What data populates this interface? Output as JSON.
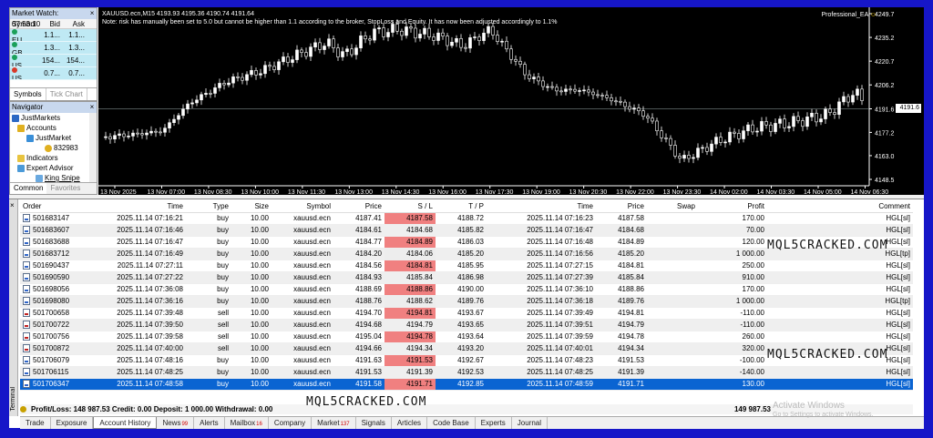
{
  "market_watch": {
    "title": "Market Watch: 07:53:10",
    "headers": [
      "Symbol",
      "Bid",
      "Ask"
    ],
    "rows": [
      {
        "symbol": "EU...",
        "bid": "1.1...",
        "ask": "1.1...",
        "color": "#1aa05a"
      },
      {
        "symbol": "GB...",
        "bid": "1.3...",
        "ask": "1.3...",
        "color": "#1aa05a"
      },
      {
        "symbol": "US...",
        "bid": "154...",
        "ask": "154...",
        "color": "#1aa05a"
      },
      {
        "symbol": "US...",
        "bid": "0.7...",
        "ask": "0.7...",
        "color": "#d83a2a"
      }
    ],
    "tabs": [
      "Symbols",
      "Tick Chart"
    ]
  },
  "navigator": {
    "title": "Navigator",
    "items": [
      "JustMarkets",
      "Accounts",
      "JustMarket",
      "832983",
      "Indicators",
      "Expert Advisor",
      "King Snipe"
    ],
    "tabs": [
      "Common",
      "Favorites"
    ]
  },
  "chart": {
    "symbol_line": "XAUUSD.ecn,M15  4193.93 4195.36 4190.74 4191.64",
    "note": "Note: risk has manually been set to 5.0 but cannot be higher than 1.1 according to the broker, StopLoss and Equity. It has now been adjusted accordingly to 1.1%",
    "ea_name": "Professional_EA",
    "price_labels": [
      "4249.7",
      "4235.2",
      "4220.7",
      "4206.2",
      "4191.6",
      "4177.2",
      "4163.0",
      "4148.5"
    ],
    "current_price": "4191.6",
    "time_labels": [
      "13 Nov 2025",
      "13 Nov 07:00",
      "13 Nov 08:30",
      "13 Nov 10:00",
      "13 Nov 11:30",
      "13 Nov 13:00",
      "13 Nov 14:30",
      "13 Nov 16:00",
      "13 Nov 17:30",
      "13 Nov 19:00",
      "13 Nov 20:30",
      "13 Nov 22:00",
      "13 Nov 23:30",
      "14 Nov 02:00",
      "14 Nov 03:30",
      "14 Nov 05:00",
      "14 Nov 06:30"
    ],
    "colors": {
      "bull": "#ffffff",
      "bear": "#000000",
      "grid": "#ffffff"
    }
  },
  "terminal": {
    "side_label": "Terminal",
    "headers": [
      "Order",
      "Time",
      "Type",
      "Size",
      "Symbol",
      "Price",
      "S / L",
      "T / P",
      "Time",
      "Price",
      "Swap",
      "Profit",
      "Comment"
    ],
    "rows": [
      [
        "501683147",
        "2025.11.14 07:16:21",
        "buy",
        "10.00",
        "xauusd.ecn",
        "4187.41",
        "4187.58",
        "4188.72",
        "2025.11.14 07:16:23",
        "4187.58",
        "",
        "170.00",
        "HGL[sl]"
      ],
      [
        "501683607",
        "2025.11.14 07:16:46",
        "buy",
        "10.00",
        "xauusd.ecn",
        "4184.61",
        "4184.68",
        "4185.82",
        "2025.11.14 07:16:47",
        "4184.68",
        "",
        "70.00",
        "HGL[sl]"
      ],
      [
        "501683688",
        "2025.11.14 07:16:47",
        "buy",
        "10.00",
        "xauusd.ecn",
        "4184.77",
        "4184.89",
        "4186.03",
        "2025.11.14 07:16:48",
        "4184.89",
        "",
        "120.00",
        "HGL[sl]"
      ],
      [
        "501683712",
        "2025.11.14 07:16:49",
        "buy",
        "10.00",
        "xauusd.ecn",
        "4184.20",
        "4184.06",
        "4185.20",
        "2025.11.14 07:16:56",
        "4185.20",
        "",
        "1 000.00",
        "HGL[tp]"
      ],
      [
        "501690437",
        "2025.11.14 07:27:11",
        "buy",
        "10.00",
        "xauusd.ecn",
        "4184.56",
        "4184.81",
        "4185.95",
        "2025.11.14 07:27:15",
        "4184.81",
        "",
        "250.00",
        "HGL[sl]"
      ],
      [
        "501690590",
        "2025.11.14 07:27:22",
        "buy",
        "10.00",
        "xauusd.ecn",
        "4184.93",
        "4185.84",
        "4186.98",
        "2025.11.14 07:27:39",
        "4185.84",
        "",
        "910.00",
        "HGL[sl]"
      ],
      [
        "501698056",
        "2025.11.14 07:36:08",
        "buy",
        "10.00",
        "xauusd.ecn",
        "4188.69",
        "4188.86",
        "4190.00",
        "2025.11.14 07:36:10",
        "4188.86",
        "",
        "170.00",
        "HGL[sl]"
      ],
      [
        "501698080",
        "2025.11.14 07:36:16",
        "buy",
        "10.00",
        "xauusd.ecn",
        "4188.76",
        "4188.62",
        "4189.76",
        "2025.11.14 07:36:18",
        "4189.76",
        "",
        "1 000.00",
        "HGL[tp]"
      ],
      [
        "501700658",
        "2025.11.14 07:39:48",
        "sell",
        "10.00",
        "xauusd.ecn",
        "4194.70",
        "4194.81",
        "4193.67",
        "2025.11.14 07:39:49",
        "4194.81",
        "",
        "-110.00",
        "HGL[sl]"
      ],
      [
        "501700722",
        "2025.11.14 07:39:50",
        "sell",
        "10.00",
        "xauusd.ecn",
        "4194.68",
        "4194.79",
        "4193.65",
        "2025.11.14 07:39:51",
        "4194.79",
        "",
        "-110.00",
        "HGL[sl]"
      ],
      [
        "501700756",
        "2025.11.14 07:39:58",
        "sell",
        "10.00",
        "xauusd.ecn",
        "4195.04",
        "4194.78",
        "4193.64",
        "2025.11.14 07:39:59",
        "4194.78",
        "",
        "260.00",
        "HGL[sl]"
      ],
      [
        "501700872",
        "2025.11.14 07:40:00",
        "sell",
        "10.00",
        "xauusd.ecn",
        "4194.66",
        "4194.34",
        "4193.20",
        "2025.11.14 07:40:01",
        "4194.34",
        "",
        "320.00",
        "HGL[sl]"
      ],
      [
        "501706079",
        "2025.11.14 07:48:16",
        "buy",
        "10.00",
        "xauusd.ecn",
        "4191.63",
        "4191.53",
        "4192.67",
        "2025.11.14 07:48:23",
        "4191.53",
        "",
        "-100.00",
        "HGL[sl]"
      ],
      [
        "501706115",
        "2025.11.14 07:48:25",
        "buy",
        "10.00",
        "xauusd.ecn",
        "4191.53",
        "4191.39",
        "4192.53",
        "2025.11.14 07:48:25",
        "4191.39",
        "",
        "-140.00",
        "HGL[sl]"
      ],
      [
        "501706347",
        "2025.11.14 07:48:58",
        "buy",
        "10.00",
        "xauusd.ecn",
        "4191.58",
        "4191.71",
        "4192.85",
        "2025.11.14 07:48:59",
        "4191.71",
        "",
        "130.00",
        "HGL[sl]"
      ]
    ],
    "sl_pale_rows": [
      3,
      7
    ],
    "tp_hit_rows": [
      3,
      7
    ],
    "selected_row": 14,
    "summary": "Profit/Loss: 148 987.53  Credit: 0.00  Deposit: 1 000.00  Withdrawal: 0.00",
    "summary_total": "149 987.53",
    "tabs": [
      {
        "label": "Trade",
        "badge": ""
      },
      {
        "label": "Exposure",
        "badge": ""
      },
      {
        "label": "Account History",
        "badge": ""
      },
      {
        "label": "News",
        "badge": "99"
      },
      {
        "label": "Alerts",
        "badge": ""
      },
      {
        "label": "Mailbox",
        "badge": "16"
      },
      {
        "label": "Company",
        "badge": ""
      },
      {
        "label": "Market",
        "badge": "137"
      },
      {
        "label": "Signals",
        "badge": ""
      },
      {
        "label": "Articles",
        "badge": ""
      },
      {
        "label": "Code Base",
        "badge": ""
      },
      {
        "label": "Experts",
        "badge": ""
      },
      {
        "label": "Journal",
        "badge": ""
      }
    ],
    "active_tab": 2
  },
  "watermarks": [
    "MQL5CRACKED.COM",
    "MQL5CRACKED.COM",
    "MQL5CRACKED.COM"
  ],
  "os_notice": {
    "title": "Activate Windows",
    "subtitle": "Go to Settings to activate Windows."
  }
}
